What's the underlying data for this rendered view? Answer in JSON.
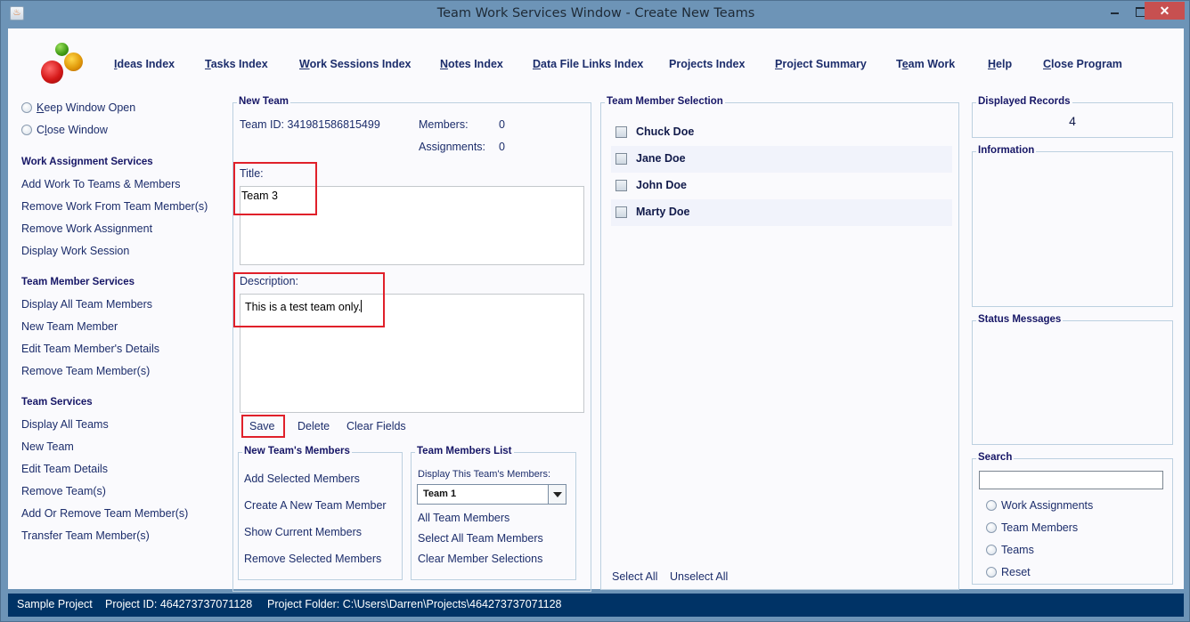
{
  "window": {
    "title": "Team Work Services Window - Create New Teams",
    "controls": {
      "minimize": "minimize",
      "maximize": "maximize",
      "close": "✕"
    },
    "icon": "java-app-icon"
  },
  "topnav": [
    {
      "label": "Ideas Index",
      "mnemonic": "I"
    },
    {
      "label": "Tasks Index",
      "mnemonic": "T"
    },
    {
      "label": "Work Sessions Index",
      "mnemonic": "W"
    },
    {
      "label": "Notes Index",
      "mnemonic": "N"
    },
    {
      "label": "Data File Links Index",
      "mnemonic": "D"
    },
    {
      "label": "Projects Index",
      "mnemonic": ""
    },
    {
      "label": "Project Summary",
      "mnemonic": "P"
    },
    {
      "label": "Team Work",
      "mnemonic": "e"
    },
    {
      "label": "Help",
      "mnemonic": "H"
    },
    {
      "label": "Close Program",
      "mnemonic": "C"
    }
  ],
  "sidebar": {
    "window_options": [
      {
        "label": "Keep Window Open",
        "selected": false
      },
      {
        "label": "Close Window",
        "selected": false
      }
    ],
    "sections": [
      {
        "heading": "Work Assignment Services",
        "items": [
          "Add Work To Teams & Members",
          "Remove Work From Team Member(s)",
          "Remove Work Assignment",
          "Display Work Session"
        ]
      },
      {
        "heading": "Team Member Services",
        "items": [
          "Display All Team Members",
          "New Team Member",
          "Edit Team Member's Details",
          "Remove Team Member(s)"
        ]
      },
      {
        "heading": "Team Services",
        "items": [
          "Display All Teams",
          "New Team",
          "Edit Team Details",
          "Remove Team(s)",
          "Add Or Remove Team Member(s)",
          "Transfer Team Member(s)"
        ]
      }
    ]
  },
  "new_team": {
    "group_title": "New Team",
    "team_id_label": "Team ID:",
    "team_id": "341981586815499",
    "members_label": "Members:",
    "members_count": "0",
    "assignments_label": "Assignments:",
    "assignments_count": "0",
    "title_label": "Title:",
    "title_value": "Team 3",
    "description_label": "Description:",
    "description_value": "This is a test team only.",
    "actions": {
      "save": "Save",
      "delete": "Delete",
      "clear": "Clear Fields"
    }
  },
  "new_team_members": {
    "group_title": "New Team's Members",
    "items": [
      "Add Selected Members",
      "Create A New Team Member",
      "Show Current Members",
      "Remove Selected Members"
    ]
  },
  "team_members_list": {
    "group_title": "Team Members List",
    "display_label": "Display This Team's Members:",
    "selected_team": "Team 1",
    "items": [
      "All Team Members",
      "Select All Team Members",
      "Clear Member Selections"
    ]
  },
  "member_selection": {
    "group_title": "Team Member Selection",
    "members": [
      {
        "name": "Chuck Doe",
        "checked": false
      },
      {
        "name": "Jane Doe",
        "checked": false
      },
      {
        "name": "John Doe",
        "checked": false
      },
      {
        "name": "Marty Doe",
        "checked": false
      }
    ],
    "select_all": "Select All",
    "unselect_all": "Unselect All"
  },
  "right_panel": {
    "displayed_records_title": "Displayed Records",
    "displayed_records": "4",
    "information_title": "Information",
    "status_messages_title": "Status Messages",
    "search_title": "Search",
    "search_value": "",
    "search_options": [
      "Work Assignments",
      "Team Members",
      "Teams",
      "Reset"
    ]
  },
  "statusbar": {
    "project_name": "Sample Project",
    "project_id": "Project ID:  464273737071128",
    "project_folder": "Project Folder: C:\\Users\\Darren\\Projects\\464273737071128"
  },
  "colors": {
    "window_frame": "#6d94b7",
    "close_button": "#c75050",
    "link_text": "#1c2d6b",
    "heading_text": "#161666",
    "status_bar": "#003366",
    "highlight_box": "#e0202a"
  }
}
